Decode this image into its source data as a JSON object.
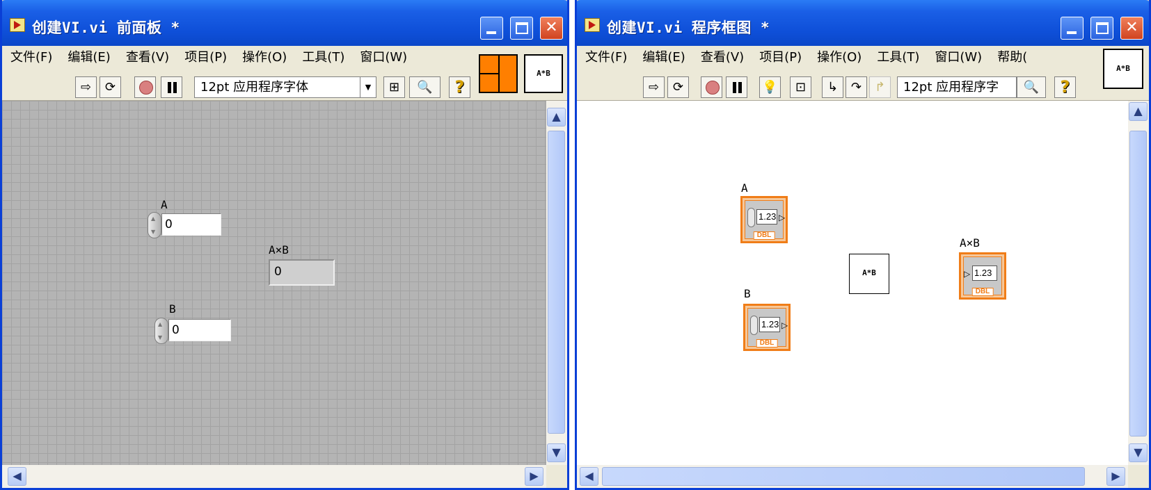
{
  "front_panel": {
    "title": "创建VI.vi 前面板 *",
    "menu": [
      "文件(F)",
      "编辑(E)",
      "查看(V)",
      "项目(P)",
      "操作(O)",
      "工具(T)",
      "窗口(W)"
    ],
    "font_label": "12pt 应用程序字体",
    "icon_text": "A*B",
    "controls": {
      "a": {
        "label": "A",
        "value": "0"
      },
      "b": {
        "label": "B",
        "value": "0"
      },
      "product": {
        "label": "A×B",
        "value": "0"
      }
    }
  },
  "block_diagram": {
    "title": "创建VI.vi 程序框图 *",
    "menu": [
      "文件(F)",
      "编辑(E)",
      "查看(V)",
      "项目(P)",
      "操作(O)",
      "工具(T)",
      "窗口(W)",
      "帮助("
    ],
    "font_label": "12pt 应用程序字",
    "icon_text": "A*B",
    "terminals": {
      "a": {
        "label": "A",
        "value": "1.23",
        "type": "DBL"
      },
      "b": {
        "label": "B",
        "value": "1.23",
        "type": "DBL"
      },
      "product": {
        "label": "A×B",
        "value": "1.23",
        "type": "DBL"
      }
    },
    "node_text": "A*B"
  },
  "icons": {
    "run": "run-arrow-icon",
    "run_continuously": "run-continuously-icon",
    "abort": "abort-stop-icon",
    "pause": "pause-icon",
    "highlight": "lightbulb-icon",
    "retain": "retain-wire-values-icon",
    "step_into": "step-into-icon",
    "step_over": "step-over-icon",
    "step_out": "step-out-icon",
    "align": "align-objects-icon",
    "search": "search-icon",
    "help": "context-help-icon"
  },
  "colors": {
    "title_bar": "#0e4fd8",
    "grid_background": "#b4b4b4",
    "dbl_terminal": "#f07d18",
    "connector": "#ff7f00"
  }
}
